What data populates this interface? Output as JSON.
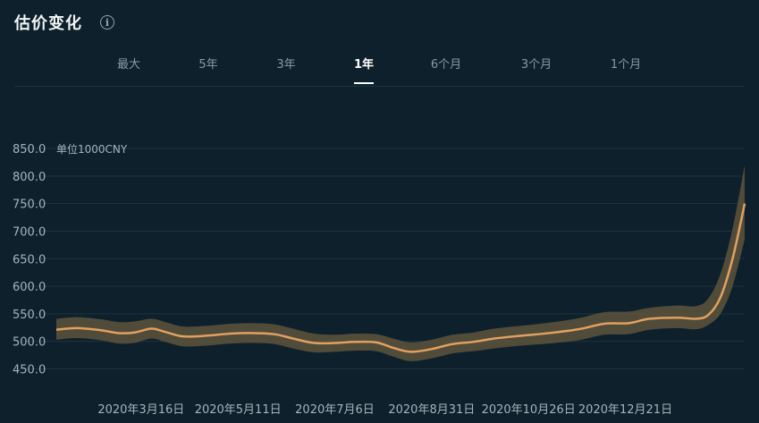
{
  "header": {
    "title": "估价变化",
    "info_icon": "info-icon"
  },
  "tabs": [
    {
      "label": "最大",
      "active": false
    },
    {
      "label": "5年",
      "active": false
    },
    {
      "label": "3年",
      "active": false
    },
    {
      "label": "1年",
      "active": true
    },
    {
      "label": "6个月",
      "active": false
    },
    {
      "label": "3个月",
      "active": false
    },
    {
      "label": "1个月",
      "active": false
    }
  ],
  "colors": {
    "line": "#e0a160",
    "band": "#5e533d",
    "background": "#0d202b",
    "grid": "#1e3441"
  },
  "chart_data": {
    "type": "line",
    "unit_label": "单位1000CNY",
    "ylim": [
      450,
      850
    ],
    "yticks": [
      "850.0",
      "800.0",
      "750.0",
      "700.0",
      "650.0",
      "600.0",
      "550.0",
      "500.0",
      "450.0"
    ],
    "xticks": [
      "2020年3月16日",
      "2020年5月11日",
      "2020年7月6日",
      "2020年8月31日",
      "2020年10月26日",
      "2020年12月21日"
    ],
    "grid": true,
    "series": [
      {
        "points": [
          [
            "2020-01-27",
            521
          ],
          [
            "2020-02-08",
            524
          ],
          [
            "2020-02-22",
            520
          ],
          [
            "2020-03-03",
            515
          ],
          [
            "2020-03-12",
            516
          ],
          [
            "2020-03-22",
            523
          ],
          [
            "2020-03-30",
            517
          ],
          [
            "2020-04-09",
            509
          ],
          [
            "2020-04-22",
            510
          ],
          [
            "2020-05-07",
            514
          ],
          [
            "2020-05-20",
            515
          ],
          [
            "2020-06-01",
            513
          ],
          [
            "2020-06-12",
            505
          ],
          [
            "2020-06-24",
            497
          ],
          [
            "2020-07-06",
            497
          ],
          [
            "2020-07-18",
            499
          ],
          [
            "2020-07-30",
            498
          ],
          [
            "2020-08-09",
            488
          ],
          [
            "2020-08-19",
            481
          ],
          [
            "2020-08-31",
            486
          ],
          [
            "2020-09-12",
            495
          ],
          [
            "2020-09-24",
            499
          ],
          [
            "2020-10-06",
            505
          ],
          [
            "2020-10-21",
            510
          ],
          [
            "2020-11-07",
            515
          ],
          [
            "2020-11-24",
            522
          ],
          [
            "2020-12-09",
            532
          ],
          [
            "2020-12-23",
            533
          ],
          [
            "2021-01-04",
            541
          ],
          [
            "2021-01-20",
            543
          ],
          [
            "2021-01-31",
            541
          ],
          [
            "2021-02-07",
            548
          ],
          [
            "2021-02-14",
            580
          ],
          [
            "2021-02-21",
            650
          ],
          [
            "2021-02-28",
            750
          ]
        ],
        "band_upper": [
          541,
          544,
          540,
          535,
          536,
          541,
          535,
          527,
          528,
          532,
          533,
          531,
          523,
          514,
          512,
          514,
          513,
          505,
          498,
          503,
          512,
          516,
          523,
          528,
          534,
          542,
          553,
          554,
          561,
          565,
          564,
          578,
          623,
          705,
          820
        ],
        "band_lower": [
          503,
          506,
          502,
          496,
          497,
          505,
          499,
          491,
          492,
          496,
          497,
          495,
          487,
          480,
          481,
          483,
          482,
          472,
          464,
          469,
          478,
          482,
          487,
          492,
          496,
          502,
          512,
          513,
          521,
          524,
          522,
          530,
          550,
          600,
          685
        ]
      }
    ]
  }
}
